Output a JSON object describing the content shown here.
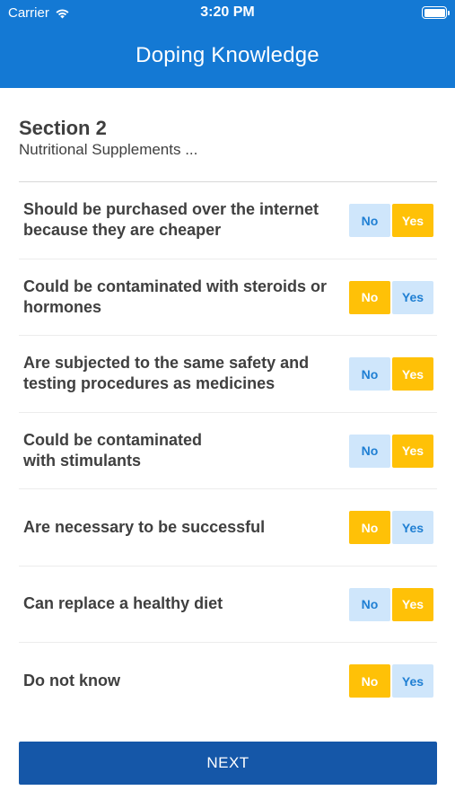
{
  "status_bar": {
    "carrier": "Carrier",
    "time": "3:20 PM",
    "wifi_icon": "wifi-icon",
    "battery_icon": "battery-icon"
  },
  "nav": {
    "title": "Doping Knowledge"
  },
  "section": {
    "title": "Section 2",
    "subtitle": "Nutritional Supplements ..."
  },
  "colors": {
    "header": "#1479d4",
    "selected": "#ffc107",
    "unselected": "#cfe6fb",
    "button": "#1557a8"
  },
  "questions": [
    {
      "text": "Should be purchased over the internet because they are cheaper",
      "no_label": "No",
      "yes_label": "Yes",
      "selected": "Yes"
    },
    {
      "text": "Could be contaminated with steroids or hormones",
      "no_label": "No",
      "yes_label": "Yes",
      "selected": "No"
    },
    {
      "text": "Are subjected to the same safety and testing procedures as medicines",
      "no_label": "No",
      "yes_label": "Yes",
      "selected": "Yes"
    },
    {
      "text": "Could be contaminated with stimulants",
      "no_label": "No",
      "yes_label": "Yes",
      "selected": "Yes"
    },
    {
      "text": "Are necessary to be successful",
      "no_label": "No",
      "yes_label": "Yes",
      "selected": "No"
    },
    {
      "text": "Can replace a healthy diet",
      "no_label": "No",
      "yes_label": "Yes",
      "selected": "Yes"
    },
    {
      "text": "Do not know",
      "no_label": "No",
      "yes_label": "Yes",
      "selected": "No"
    }
  ],
  "next_button": {
    "label": "NEXT"
  }
}
